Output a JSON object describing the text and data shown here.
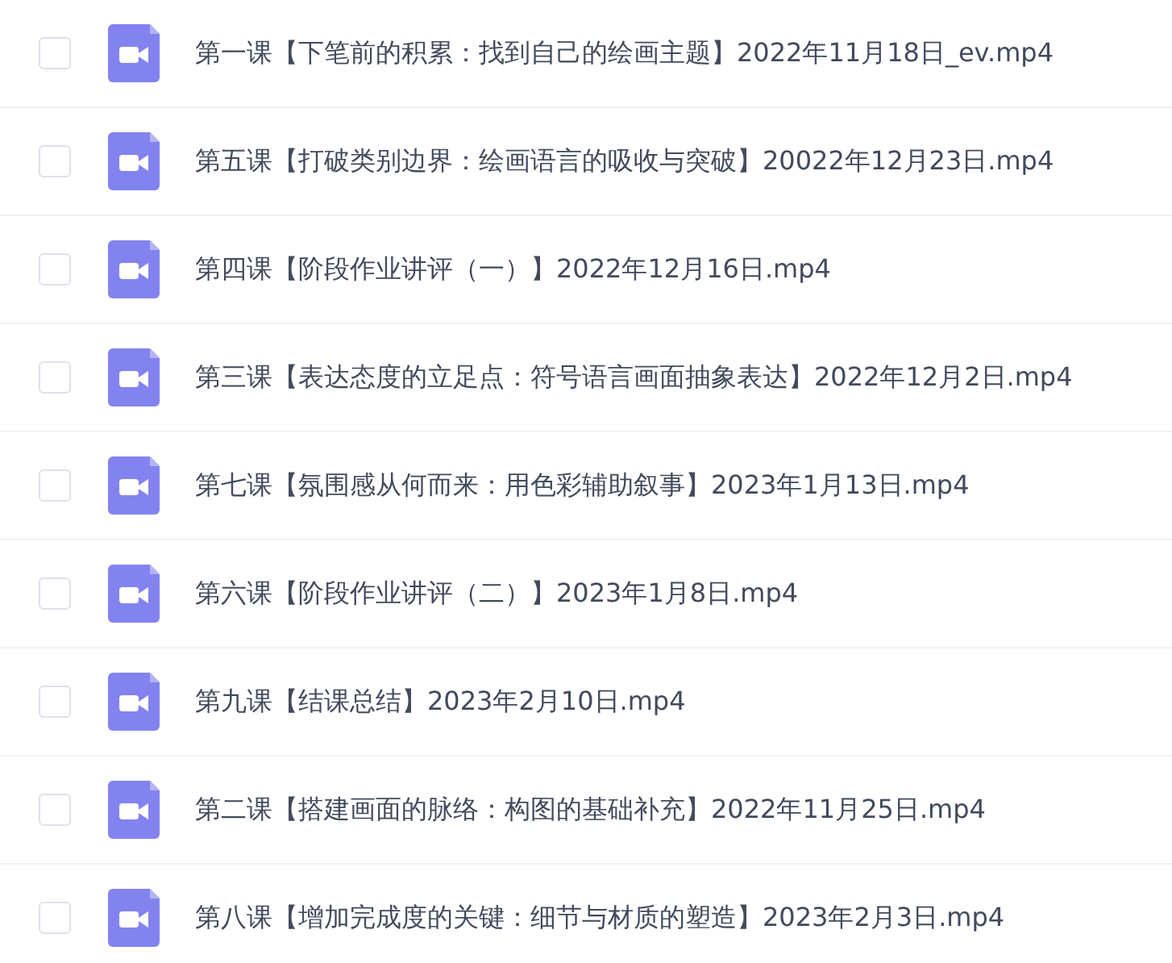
{
  "files": [
    {
      "name": "第一课【下笔前的积累：找到自己的绘画主题】2022年11月18日_ev.mp4",
      "checked": false
    },
    {
      "name": "第五课【打破类别边界：绘画语言的吸收与突破】20022年12月23日.mp4",
      "checked": false
    },
    {
      "name": "第四课【阶段作业讲评（一）】2022年12月16日.mp4",
      "checked": false
    },
    {
      "name": "第三课【表达态度的立足点：符号语言画面抽象表达】2022年12月2日.mp4",
      "checked": false
    },
    {
      "name": "第七课【氛围感从何而来：用色彩辅助叙事】2023年1月13日.mp4",
      "checked": false
    },
    {
      "name": "第六课【阶段作业讲评（二）】2023年1月8日.mp4",
      "checked": false
    },
    {
      "name": "第九课【结课总结】2023年2月10日.mp4",
      "checked": false
    },
    {
      "name": "第二课【搭建画面的脉络：构图的基础补充】2022年11月25日.mp4",
      "checked": false
    },
    {
      "name": "第八课【增加完成度的关键：细节与材质的塑造】2023年2月3日.mp4",
      "checked": false
    }
  ]
}
